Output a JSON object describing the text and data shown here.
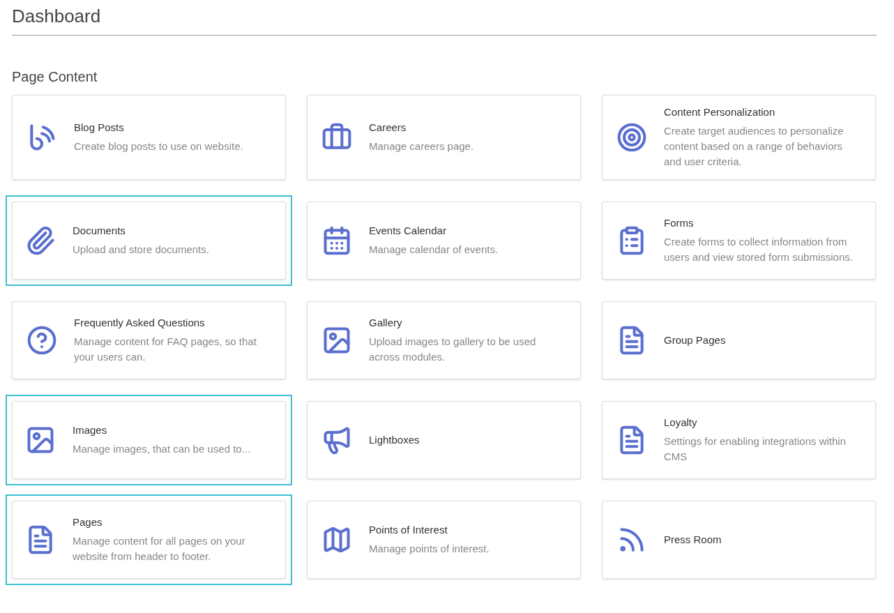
{
  "header": {
    "title": "Dashboard"
  },
  "section": {
    "title": "Page Content"
  },
  "cards": [
    {
      "title": "Blog Posts",
      "description": "Create blog posts to use on website.",
      "highlighted": false
    },
    {
      "title": "Careers",
      "description": "Manage careers page.",
      "highlighted": false
    },
    {
      "title": "Content Personalization",
      "description": "Create target audiences to personalize content based on a range of behaviors and user criteria.",
      "highlighted": false
    },
    {
      "title": "Documents",
      "description": "Upload and store documents.",
      "highlighted": true
    },
    {
      "title": "Events Calendar",
      "description": "Manage calendar of events.",
      "highlighted": false
    },
    {
      "title": "Forms",
      "description": "Create forms to collect information from users and view stored form submissions.",
      "highlighted": false
    },
    {
      "title": "Frequently Asked Questions",
      "description": "Manage content for FAQ pages, so that your users can.",
      "highlighted": false
    },
    {
      "title": "Gallery",
      "description": "Upload images to gallery to be used across modules.",
      "highlighted": false
    },
    {
      "title": "Group Pages",
      "highlighted": false
    },
    {
      "title": "Images",
      "description": "Manage images, that can be used to...",
      "highlighted": true
    },
    {
      "title": "Lightboxes",
      "highlighted": false
    },
    {
      "title": "Loyalty",
      "description": "Settings for enabling integrations within CMS",
      "highlighted": false
    },
    {
      "title": "Pages",
      "description": "Manage content for all pages on your website from header to footer.",
      "highlighted": true
    },
    {
      "title": "Points of Interest",
      "description": "Manage points of interest.",
      "highlighted": false
    },
    {
      "title": "Press Room",
      "highlighted": false
    }
  ]
}
